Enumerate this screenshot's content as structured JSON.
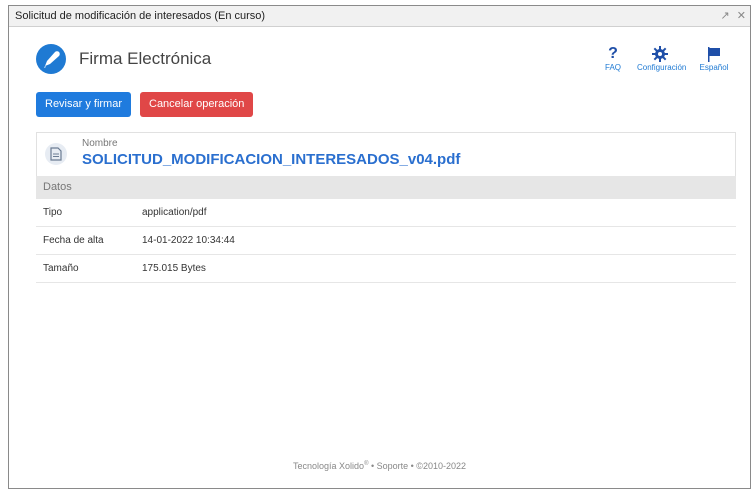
{
  "window": {
    "title": "Solicitud de modificación de interesados (En curso)",
    "btns": [
      "↗",
      "✕"
    ]
  },
  "header": {
    "app_title": "Firma Electrónica",
    "nav": [
      {
        "label": "FAQ",
        "icon": "question-icon"
      },
      {
        "label": "Configuración",
        "icon": "gear-icon"
      },
      {
        "label": "Español",
        "icon": "flag-icon"
      }
    ]
  },
  "actions": {
    "review_sign": "Revisar y firmar",
    "cancel": "Cancelar operación"
  },
  "file": {
    "label": "Nombre",
    "name": "SOLICITUD_MODIFICACION_INTERESADOS_v04.pdf"
  },
  "details": {
    "section_title": "Datos",
    "rows": [
      {
        "key": "Tipo",
        "value": "application/pdf"
      },
      {
        "key": "Fecha de alta",
        "value": "14-01-2022 10:34:44"
      },
      {
        "key": "Tamaño",
        "value": "175.015 Bytes"
      }
    ]
  },
  "footer": {
    "brand": "Tecnología Xolido",
    "reg": "®",
    "rest": " • Soporte • ©2010-2022"
  },
  "colors": {
    "accent": "#1f7bde",
    "danger": "#e04747",
    "brand": "#1f4fa8"
  }
}
